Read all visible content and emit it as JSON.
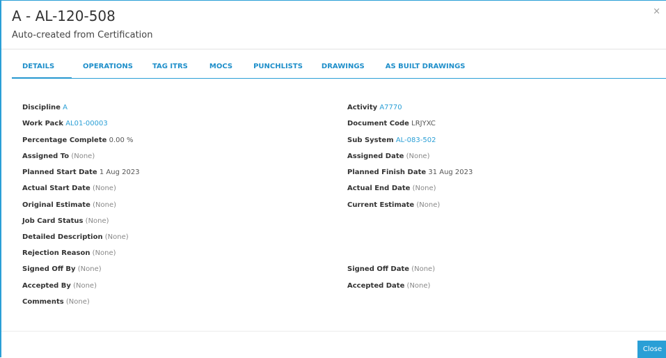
{
  "modal": {
    "title": "A - AL-120-508",
    "subtitle": "Auto-created from Certification",
    "close_icon": "×",
    "close_button_label": "Close"
  },
  "tabs": [
    {
      "label": "DETAILS",
      "active": true
    },
    {
      "label": "OPERATIONS",
      "active": false
    },
    {
      "label": "TAG ITRS",
      "active": false
    },
    {
      "label": "MOCS",
      "active": false
    },
    {
      "label": "PUNCHLISTS",
      "active": false
    },
    {
      "label": "DRAWINGS",
      "active": false
    },
    {
      "label": "AS BUILT DRAWINGS",
      "active": false
    }
  ],
  "left_fields": [
    {
      "label": "Discipline",
      "value": "A",
      "kind": "link"
    },
    {
      "label": "Work Pack",
      "value": "AL01-00003",
      "kind": "link"
    },
    {
      "label": "Percentage Complete",
      "value": "0.00 %",
      "kind": "plain"
    },
    {
      "label": "Assigned To",
      "value": "(None)",
      "kind": "none"
    },
    {
      "label": "Planned Start Date",
      "value": "1 Aug 2023",
      "kind": "plain"
    },
    {
      "label": "Actual Start Date",
      "value": "(None)",
      "kind": "none"
    },
    {
      "label": "Original Estimate",
      "value": "(None)",
      "kind": "none"
    },
    {
      "label": "Job Card Status",
      "value": "(None)",
      "kind": "none"
    },
    {
      "label": "Detailed Description",
      "value": "(None)",
      "kind": "none"
    },
    {
      "label": "Rejection Reason",
      "value": "(None)",
      "kind": "none"
    },
    {
      "label": "Signed Off By",
      "value": "(None)",
      "kind": "none"
    },
    {
      "label": "Accepted By",
      "value": "(None)",
      "kind": "none"
    },
    {
      "label": "Comments",
      "value": "(None)",
      "kind": "none"
    }
  ],
  "right_fields": [
    {
      "label": "Activity",
      "value": "A7770",
      "kind": "link"
    },
    {
      "label": "Document Code",
      "value": "LRJYXC",
      "kind": "plain"
    },
    {
      "label": "Sub System",
      "value": "AL-083-502",
      "kind": "link"
    },
    {
      "label": "Assigned Date",
      "value": "(None)",
      "kind": "none"
    },
    {
      "label": "Planned Finish Date",
      "value": "31 Aug 2023",
      "kind": "plain"
    },
    {
      "label": "Actual End Date",
      "value": "(None)",
      "kind": "none"
    },
    {
      "label": "Current Estimate",
      "value": "(None)",
      "kind": "none"
    },
    {
      "label": "Signed Off Date",
      "value": "(None)",
      "kind": "none"
    },
    {
      "label": "Accepted Date",
      "value": "(None)",
      "kind": "none"
    }
  ],
  "colors": {
    "accent": "#2a9fd6",
    "none_text": "#888888"
  }
}
